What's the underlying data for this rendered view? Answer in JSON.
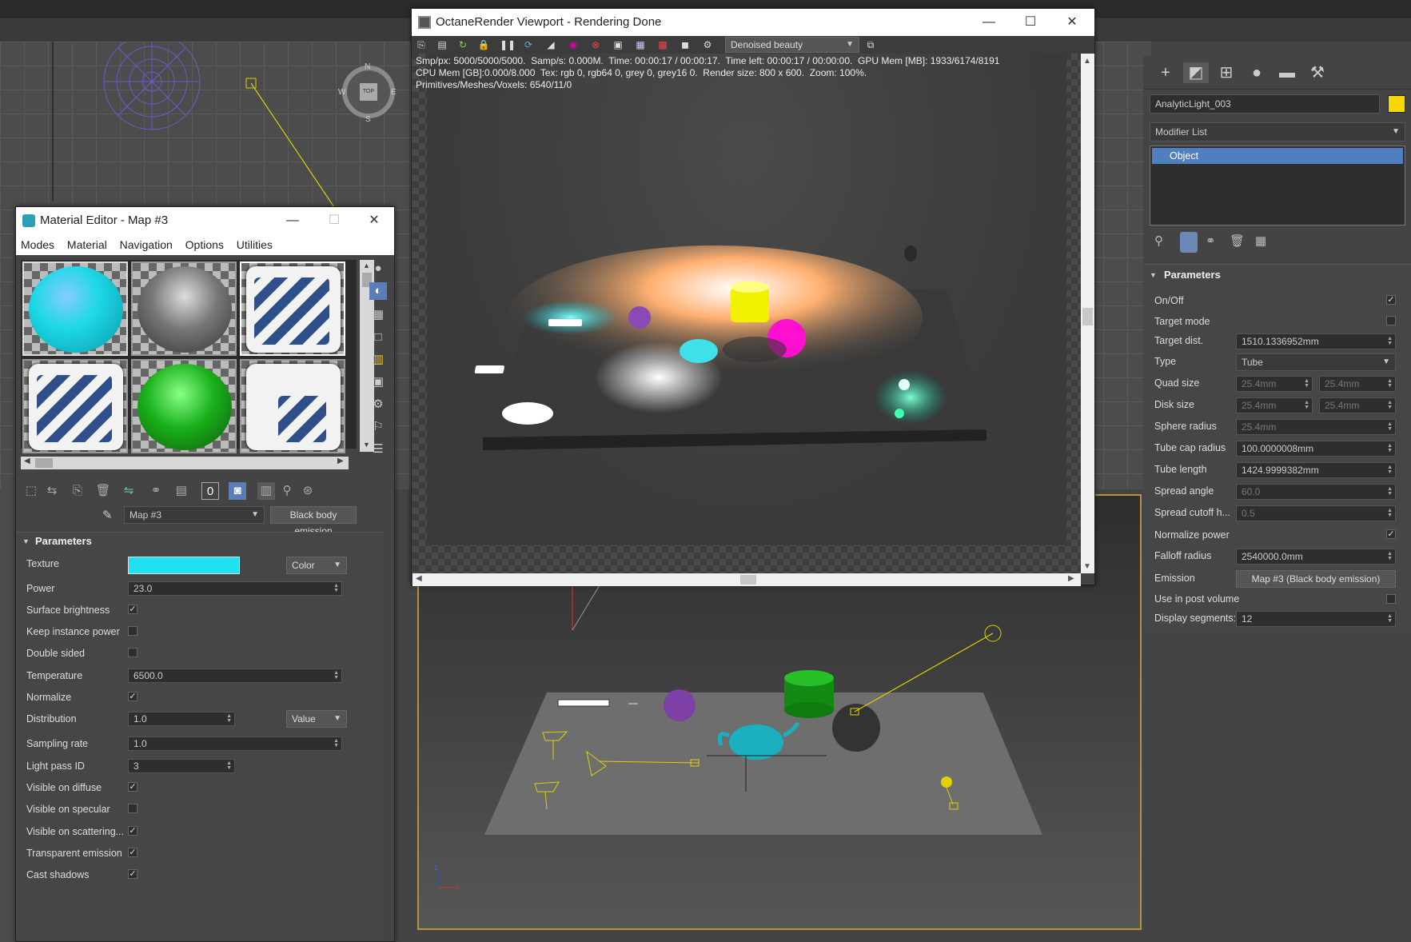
{
  "octane": {
    "title": "OctaneRender Viewport - Rendering Done",
    "render_pass": "Denoised beauty",
    "stats_line1": "Smp/px: 5000/5000/5000.  Samp/s: 0.000M.  Time: 00:00:17 / 00:00:17.  Time left: 00:00:17 / 00:00:00.  GPU Mem [MB]: 1933/6174/8191",
    "stats_line2": "CPU Mem [GB]:0.000/8.000  Tex: rgb 0, rgb64 0, grey 0, grey16 0.  Render size: 800 x 600.  Zoom: 100%.",
    "stats_line3": "Primitives/Meshes/Voxels: 6540/11/0"
  },
  "material_editor": {
    "title": "Material Editor - Map #3",
    "menu": [
      "Modes",
      "Material",
      "Navigation",
      "Options",
      "Utilities"
    ],
    "map_name": "Map #3",
    "map_type": "Black body emission",
    "section": "Parameters",
    "texture_label": "Texture",
    "texture_color": "#1ee0f0",
    "texture_mode": "Color",
    "power_label": "Power",
    "power": "23.0",
    "surface_brightness_label": "Surface brightness",
    "surface_brightness": true,
    "keep_instance_power_label": "Keep instance power",
    "keep_instance_power": false,
    "double_sided_label": "Double sided",
    "double_sided": false,
    "temperature_label": "Temperature",
    "temperature": "6500.0",
    "normalize_label": "Normalize",
    "normalize": true,
    "distribution_label": "Distribution",
    "distribution": "1.0",
    "distribution_mode": "Value",
    "sampling_rate_label": "Sampling rate",
    "sampling_rate": "1.0",
    "light_pass_id_label": "Light pass ID",
    "light_pass_id": "3",
    "visible_on_diffuse_label": "Visible on diffuse",
    "visible_on_diffuse": true,
    "visible_on_specular_label": "Visible on specular",
    "visible_on_specular": false,
    "visible_on_scattering_label": "Visible on scattering...",
    "visible_on_scattering": true,
    "transparent_emission_label": "Transparent emission",
    "transparent_emission": true,
    "cast_shadows_label": "Cast shadows",
    "cast_shadows": true,
    "check_mark": "✓",
    "sample_slots": [
      "cyan-sphere",
      "grey-sphere",
      "stripe-decal",
      "stripe-decal",
      "green-sphere",
      "stripe-decal-yellow"
    ]
  },
  "command_panel": {
    "object_name": "AnalyticLight_003",
    "object_color": "#f5d800",
    "modifier_list": "Modifier List",
    "stack_item": "Object",
    "section": "Parameters",
    "on_off_label": "On/Off",
    "on_off": true,
    "target_mode_label": "Target mode",
    "target_mode": false,
    "target_dist_label": "Target dist.",
    "target_dist": "1510.1336952mm",
    "type_label": "Type",
    "type": "Tube",
    "quad_size_label": "Quad size",
    "quad_size_a": "25.4mm",
    "quad_size_b": "25.4mm",
    "disk_size_label": "Disk size",
    "disk_size_a": "25.4mm",
    "disk_size_b": "25.4mm",
    "sphere_radius_label": "Sphere radius",
    "sphere_radius": "25.4mm",
    "tube_cap_radius_label": "Tube cap radius",
    "tube_cap_radius": "100.0000008mm",
    "tube_length_label": "Tube length",
    "tube_length": "1424.9999382mm",
    "spread_angle_label": "Spread angle",
    "spread_angle": "60.0",
    "spread_cutoff_label": "Spread cutoff h...",
    "spread_cutoff": "0.5",
    "normalize_power_label": "Normalize power",
    "normalize_power": true,
    "falloff_radius_label": "Falloff radius",
    "falloff_radius": "2540000.0mm",
    "emission_label": "Emission",
    "emission": "Map #3 (Black body emission)",
    "use_in_post_volume_label": "Use in post volume",
    "use_in_post_volume": false,
    "display_segments_label": "Display segments:",
    "display_segments": "12"
  },
  "viewcube": {
    "n": "N",
    "s": "S",
    "e": "E",
    "w": "W",
    "top": "TOP"
  },
  "axis": {
    "z": "z",
    "y": "y",
    "x": "x"
  }
}
